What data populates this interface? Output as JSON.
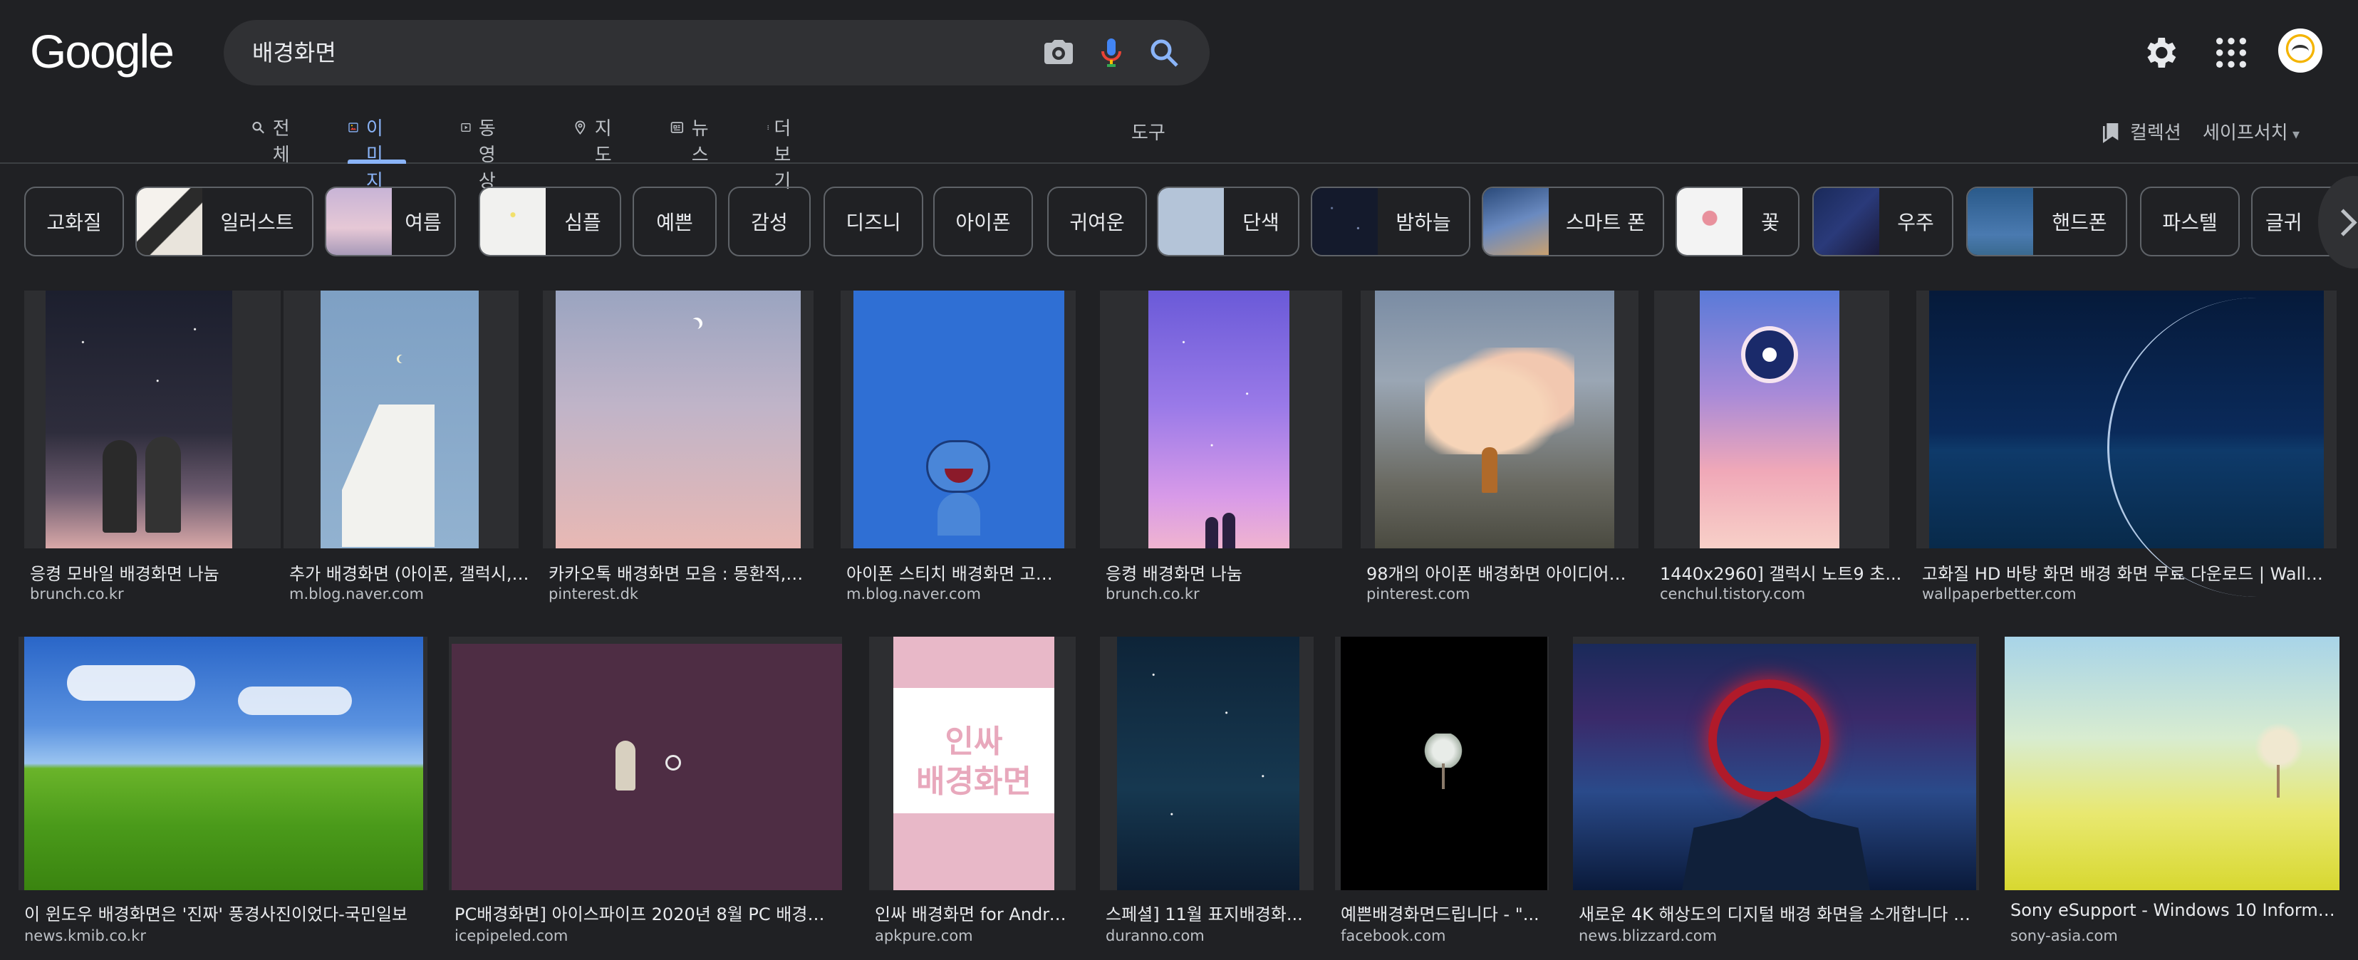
{
  "logo": "Google",
  "search": {
    "query": "배경화면"
  },
  "header_icons": [
    "camera-icon",
    "mic-icon",
    "search-icon",
    "settings-icon",
    "apps-icon"
  ],
  "tabs": [
    {
      "label": "전체",
      "icon": "search-icon"
    },
    {
      "label": "이미지",
      "icon": "image-icon",
      "active": true
    },
    {
      "label": "동영상",
      "icon": "video-icon"
    },
    {
      "label": "지도",
      "icon": "map-pin-icon"
    },
    {
      "label": "뉴스",
      "icon": "news-icon"
    },
    {
      "label": "더보기",
      "icon": "more-vert-icon"
    }
  ],
  "tools": "도구",
  "collections": "컬렉션",
  "safesearch": "세이프서치",
  "chips": [
    "고화질",
    "일러스트",
    "여름",
    "심플",
    "예쁜",
    "감성",
    "디즈니",
    "아이폰",
    "귀여운",
    "단색",
    "밤하늘",
    "스마트 폰",
    "꽃",
    "우주",
    "핸드폰",
    "파스텔",
    "글귀"
  ],
  "images": [
    {
      "title": "응켱 모바일 배경화면 나눔",
      "source": "brunch.co.kr"
    },
    {
      "title": "추가 배경화면 (아이폰, 갤럭시, ...",
      "source": "m.blog.naver.com"
    },
    {
      "title": "카카오톡 배경화면 모음 : 몽환적, 달...",
      "source": "pinterest.dk"
    },
    {
      "title": "아이폰 스티치 배경화면 고화질...",
      "source": "m.blog.naver.com"
    },
    {
      "title": "응켱 배경화면 나눔",
      "source": "brunch.co.kr"
    },
    {
      "title": "98개의 아이폰 배경화면 아이디어 -...",
      "source": "pinterest.com"
    },
    {
      "title": "1440x2960] 갤럭시 노트9 초...",
      "source": "cenchul.tistory.com"
    },
    {
      "title": "고화질 HD 바탕 화면 배경 화면 무료 다운로드 | Wallpape...",
      "source": "wallpaperbetter.com"
    },
    {
      "title": "이 윈도우 배경화면은 '진짜' 풍경사진이었다-국민일보",
      "source": "news.kmib.co.kr"
    },
    {
      "title": "PC배경화면] 아이스파이프 2020년 8월 PC 배경화면 ...",
      "source": "icepipeled.com"
    },
    {
      "title": "인싸 배경화면 for Androi...",
      "source": "apkpure.com",
      "image_text": [
        "인싸",
        "배경화면"
      ]
    },
    {
      "title": "스페셜] 11월 표지배경화...",
      "source": "duranno.com"
    },
    {
      "title": "예쁜배경화면드립니다 - \"...",
      "source": "facebook.com"
    },
    {
      "title": "새로운 4K 해상도의 디지털 배경 화면을 소개합니다 — ...",
      "source": "news.blizzard.com"
    },
    {
      "title": "Sony eSupport - Windows 10 Informatio...",
      "source": "sony-asia.com"
    }
  ],
  "colors": {
    "background": "#202124",
    "accent": "#8ab4f8",
    "text": "#e8eaed",
    "muted": "#bdc1c6"
  }
}
